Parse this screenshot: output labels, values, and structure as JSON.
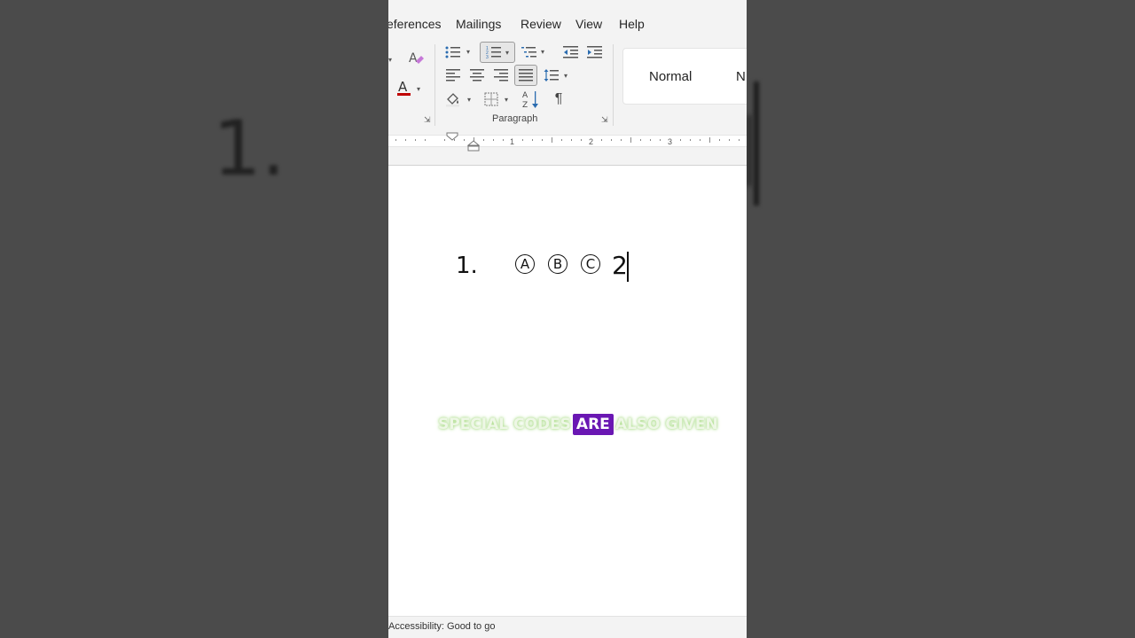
{
  "menu": {
    "items": [
      "eferences",
      "Mailings",
      "Review",
      "View",
      "Help"
    ]
  },
  "ribbon": {
    "paragraph_label": "Paragraph",
    "styles": [
      "Normal",
      "N"
    ],
    "pilcrow": "¶",
    "sort_label": "A Z",
    "font_color_letter": "A",
    "font_color": "#c00000"
  },
  "ruler": {
    "marks": [
      "1",
      "2",
      "3"
    ]
  },
  "document": {
    "list_number": "1.",
    "circled": [
      "A",
      "B",
      "C"
    ],
    "typed": "2"
  },
  "caption": {
    "before": "SPECIAL CODES",
    "highlight": "ARE",
    "after": "ALSO GIVEN",
    "highlight_color": "#6a17b3"
  },
  "status": {
    "accessibility": "Accessibility: Good to go"
  },
  "background": {
    "number": "1."
  }
}
